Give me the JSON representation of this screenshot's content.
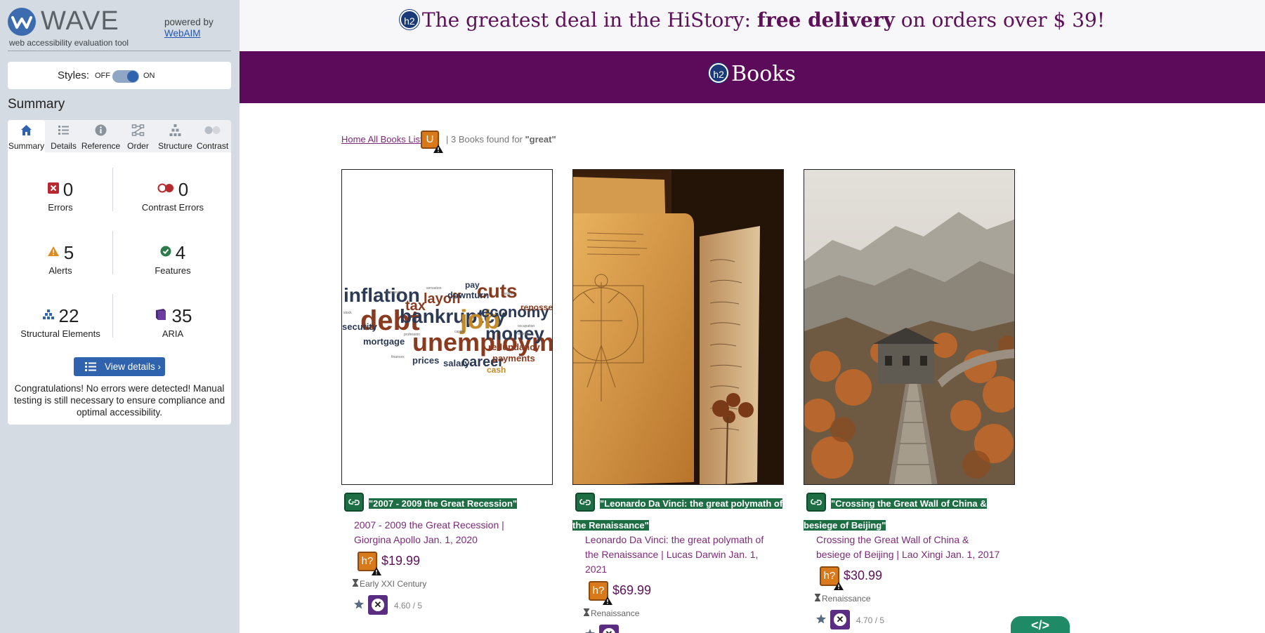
{
  "wave": {
    "title": "WAVE",
    "subtitle": "web accessibility evaluation tool",
    "powered_by": "powered by",
    "webaim": "WebAIM",
    "styles_label": "Styles:",
    "styles_off": "OFF",
    "styles_on": "ON",
    "summary_heading": "Summary",
    "tabs": [
      {
        "label": "Summary",
        "icon": "home-icon",
        "active": true
      },
      {
        "label": "Details",
        "icon": "list-icon",
        "active": false
      },
      {
        "label": "Reference",
        "icon": "info-icon",
        "active": false
      },
      {
        "label": "Order",
        "icon": "order-icon",
        "active": false
      },
      {
        "label": "Structure",
        "icon": "structure-icon",
        "active": false
      },
      {
        "label": "Contrast",
        "icon": "contrast-icon",
        "active": false
      }
    ],
    "stats": {
      "errors": {
        "count": "0",
        "label": "Errors",
        "color": "#b8282e"
      },
      "contrast_errors": {
        "count": "0",
        "label": "Contrast Errors",
        "color": "#b8282e"
      },
      "alerts": {
        "count": "5",
        "label": "Alerts",
        "color": "#e08a1e"
      },
      "features": {
        "count": "4",
        "label": "Features",
        "color": "#2d7a4a"
      },
      "structural": {
        "count": "22",
        "label": "Structural Elements",
        "color": "#2f63ad"
      },
      "aria": {
        "count": "35",
        "label": "ARIA",
        "color": "#4a2a7a"
      }
    },
    "view_details": "View details ›",
    "congrats": "Congratulations! No errors were detected! Manual testing is still necessary to ensure compliance and optimal accessibility."
  },
  "page": {
    "banner": {
      "h2": "h2",
      "prefix": "The greatest deal in the HiStory: ",
      "bold": "free delivery",
      "suffix": " on orders over $ 39!"
    },
    "section": {
      "h2": "h2",
      "title": "Books"
    },
    "breadcrumb": {
      "link": "Home All Books List",
      "badge": "U",
      "found_prefix": "| 3 Books found for ",
      "query": "\"great\""
    },
    "books": [
      {
        "title": "\"2007 - 2009 the Great Recession\"",
        "meta": "2007 - 2009 the Great Recession | Giorgina Apollo Jan. 1, 2020",
        "badge": "h?",
        "price": "$19.99",
        "era": "Early XXI Century",
        "rating": "4.60 / 5",
        "cover": "word-cloud"
      },
      {
        "title": "\"Leonardo Da Vinci: the great polymath of the Renaissance\"",
        "meta": "Leonardo Da Vinci: the great polymath of the Renaissance | Lucas Darwin Jan. 1, 2021",
        "badge": "h?",
        "price": "$69.99",
        "era": "Renaissance",
        "rating": "",
        "cover": "vitruvian-manuscript"
      },
      {
        "title": "\"Crossing the Great Wall of China & besiege of Beijing\"",
        "meta": "Crossing the Great Wall of China & besiege of Beijing | Lao Xingi Jan. 1, 2017",
        "badge": "h?",
        "price": "$30.99",
        "era": "Renaissance",
        "rating": "4.70 / 5",
        "cover": "great-wall"
      }
    ],
    "code_button": "</>",
    "word_cloud": [
      "inflation",
      "debt",
      "bankruptcy",
      "job",
      "economy",
      "cuts",
      "unemployment",
      "money",
      "layoff",
      "tax",
      "downturn",
      "security",
      "mortgage",
      "salary",
      "career",
      "payments",
      "prices",
      "cash",
      "repossession",
      "redundancy",
      "pay"
    ]
  },
  "colors": {
    "purple": "#5c0a5a",
    "wave_blue": "#2f63ad",
    "feature_green": "#1e6e45",
    "alert_orange": "#d97a1a"
  }
}
